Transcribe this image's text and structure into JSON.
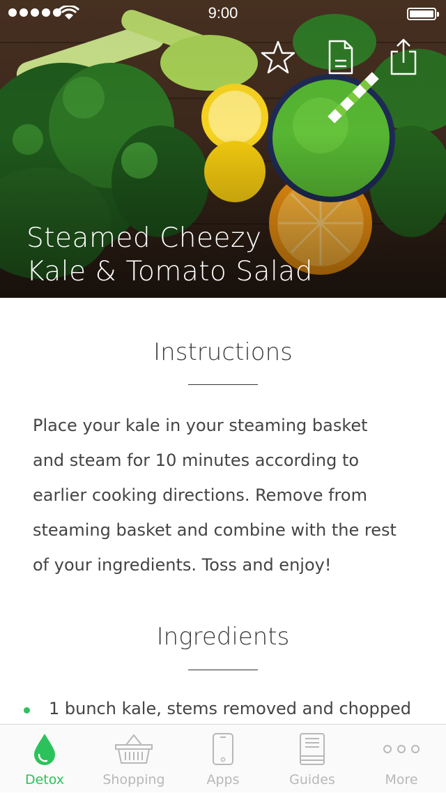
{
  "status_bar": {
    "time": "9:00"
  },
  "hero": {
    "title_lines": [
      "Steamed Cheezy",
      "Kale & Tomato Salad"
    ],
    "actions": [
      "star-icon",
      "document-icon",
      "share-icon"
    ]
  },
  "instructions": {
    "heading": "Instructions",
    "lines": [
      "Place your kale in your steaming basket",
      "and steam for 10 minutes according to",
      "earlier cooking directions. Remove from",
      "steaming basket and combine with the rest",
      "of your ingredients. Toss and enjoy!"
    ]
  },
  "ingredients": {
    "heading": "Ingredients",
    "items": [
      "1 bunch kale, stems removed and chopped"
    ]
  },
  "tabbar": {
    "tabs": [
      {
        "label": "Detox",
        "icon": "drop-icon",
        "active": true
      },
      {
        "label": "Shopping",
        "icon": "basket-icon",
        "active": false
      },
      {
        "label": "Apps",
        "icon": "phone-icon",
        "active": false
      },
      {
        "label": "Guides",
        "icon": "book-icon",
        "active": false
      },
      {
        "label": "More",
        "icon": "more-icon",
        "active": false
      }
    ]
  },
  "colors": {
    "accent": "#2cc25b",
    "inactive": "#b8b8b8",
    "text": "#444444"
  }
}
